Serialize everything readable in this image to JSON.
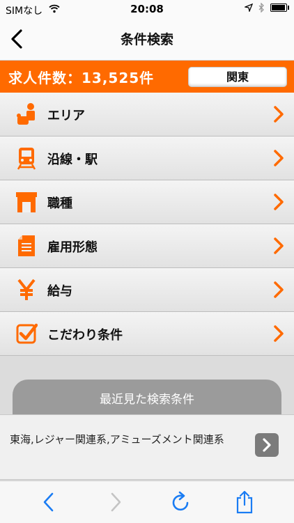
{
  "status_bar": {
    "carrier": "SIMなし",
    "time": "20:08"
  },
  "nav": {
    "title": "条件検索"
  },
  "banner": {
    "count_text": "求人件数：13,525件",
    "region_button": "関東"
  },
  "menu": {
    "items": [
      {
        "label": "エリア",
        "icon": "area-person-icon"
      },
      {
        "label": "沿線・駅",
        "icon": "train-icon"
      },
      {
        "label": "職種",
        "icon": "building-icon"
      },
      {
        "label": "雇用形態",
        "icon": "document-icon"
      },
      {
        "label": "給与",
        "icon": "yen-icon"
      },
      {
        "label": "こだわり条件",
        "icon": "checkbox-icon"
      }
    ]
  },
  "recent": {
    "header": "最近見た検索条件",
    "entry": "東海,レジャー関連系,アミューズメント関連系"
  },
  "colors": {
    "accent": "#ff6a00",
    "toolbar_blue": "#1a7cf3"
  }
}
